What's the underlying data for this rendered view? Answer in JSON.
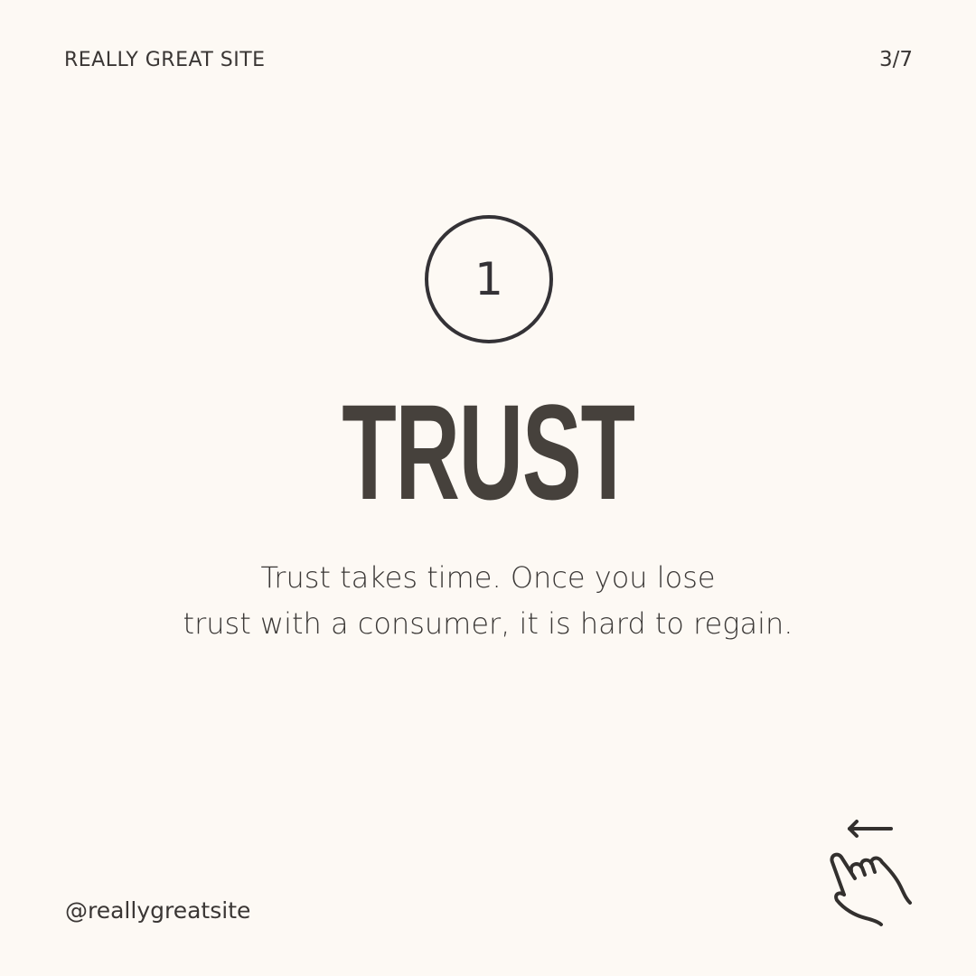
{
  "header": {
    "site_name": "REALLY GREAT SITE",
    "page_indicator": "3/7"
  },
  "main": {
    "number": "1",
    "headline": "TRUST",
    "body_lines": [
      "Trust takes time. Once you lose",
      "trust with a consumer, it is hard to regain."
    ]
  },
  "footer": {
    "handle": "@reallygreatsite",
    "swipe_icon": "swipe-left-hand-icon"
  },
  "colors": {
    "background": "#fdf9f4",
    "text": "#3a3634",
    "headline": "#46413c"
  }
}
